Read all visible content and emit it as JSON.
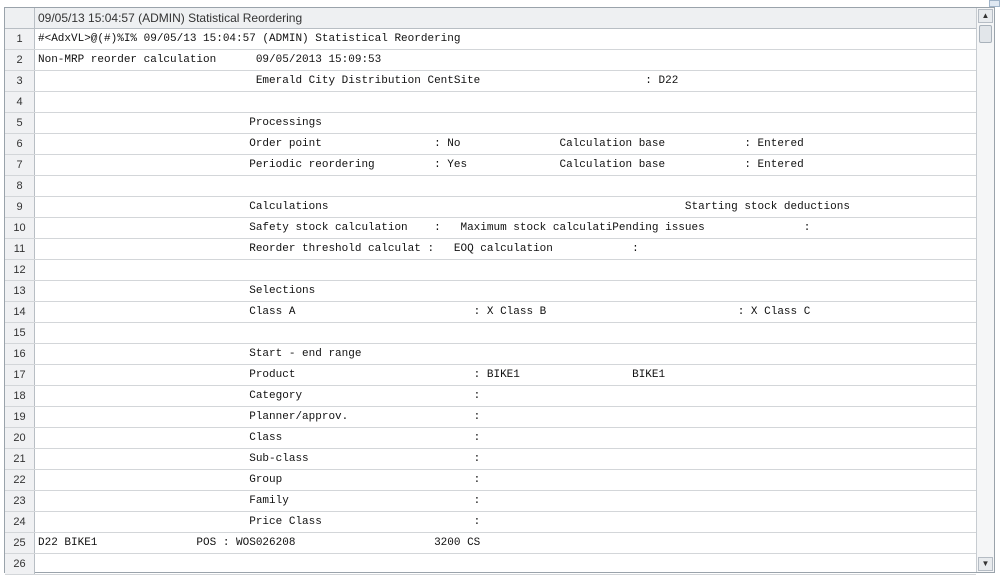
{
  "header": {
    "title": "09/05/13 15:04:57 (ADMIN) Statistical Reordering"
  },
  "rows": [
    {
      "num": "1",
      "text": "#<AdxVL>@(#)%I% 09/05/13 15:04:57 (ADMIN) Statistical Reordering"
    },
    {
      "num": "2",
      "text": "Non-MRP reorder calculation      09/05/2013 15:09:53"
    },
    {
      "num": "3",
      "text": "                                 Emerald City Distribution CentSite                         : D22"
    },
    {
      "num": "4",
      "text": ""
    },
    {
      "num": "5",
      "text": "                                Processings"
    },
    {
      "num": "6",
      "text": "                                Order point                 : No               Calculation base            : Entered"
    },
    {
      "num": "7",
      "text": "                                Periodic reordering         : Yes              Calculation base            : Entered"
    },
    {
      "num": "8",
      "text": ""
    },
    {
      "num": "9",
      "text": "                                Calculations                                                      Starting stock deductions"
    },
    {
      "num": "10",
      "text": "                                Safety stock calculation    :   Maximum stock calculatiPending issues               :"
    },
    {
      "num": "11",
      "text": "                                Reorder threshold calculat :   EOQ calculation            :"
    },
    {
      "num": "12",
      "text": ""
    },
    {
      "num": "13",
      "text": "                                Selections"
    },
    {
      "num": "14",
      "text": "                                Class A                           : X Class B                             : X Class C"
    },
    {
      "num": "15",
      "text": ""
    },
    {
      "num": "16",
      "text": "                                Start - end range"
    },
    {
      "num": "17",
      "text": "                                Product                           : BIKE1                 BIKE1"
    },
    {
      "num": "18",
      "text": "                                Category                          :"
    },
    {
      "num": "19",
      "text": "                                Planner/approv.                   :"
    },
    {
      "num": "20",
      "text": "                                Class                             :"
    },
    {
      "num": "21",
      "text": "                                Sub-class                         :"
    },
    {
      "num": "22",
      "text": "                                Group                             :"
    },
    {
      "num": "23",
      "text": "                                Family                            :"
    },
    {
      "num": "24",
      "text": "                                Price Class                       :"
    },
    {
      "num": "25",
      "text": "D22 BIKE1               POS : WOS026208                     3200 CS"
    },
    {
      "num": "26",
      "text": ""
    }
  ],
  "scrollbar": {
    "up_icon": "▲",
    "down_icon": "▼"
  }
}
